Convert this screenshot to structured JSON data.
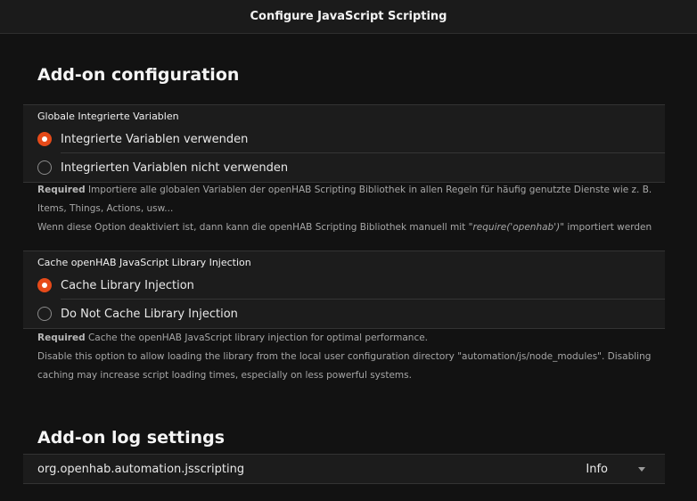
{
  "window": {
    "title": "Configure JavaScript Scripting"
  },
  "addon_configuration": {
    "title": "Add-on configuration",
    "globals": {
      "label": "Globale Integrierte Variablen",
      "options": [
        {
          "label": "Integrierte Variablen verwenden",
          "selected": true
        },
        {
          "label": "Integrierten Variablen nicht verwenden",
          "selected": false
        }
      ],
      "required": "Required",
      "desc_line1": " Importiere alle globalen Variablen der openHAB Scripting Bibliothek in allen Regeln für häufig genutzte Dienste wie z. B. Items, Things, Actions, usw...",
      "desc_line2_pre": "Wenn diese Option deaktiviert ist, dann kann die openHAB Scripting Bibliothek manuell mit \"",
      "desc_line2_code": "require('openhab')",
      "desc_line2_post": "\" importiert werden"
    },
    "cache": {
      "label": "Cache openHAB JavaScript Library Injection",
      "options": [
        {
          "label": "Cache Library Injection",
          "selected": true
        },
        {
          "label": "Do Not Cache Library Injection",
          "selected": false
        }
      ],
      "required": "Required",
      "desc_line1": " Cache the openHAB JavaScript library injection for optimal performance.",
      "desc_line2": "Disable this option to allow loading the library from the local user configuration directory \"automation/js/node_modules\". Disabling caching may increase script loading times, especially on less powerful systems."
    }
  },
  "log_settings": {
    "title": "Add-on log settings",
    "logger": "org.openhab.automation.jsscripting",
    "level": "Info"
  },
  "colors": {
    "accent": "#e64a19",
    "background": "#121212",
    "panel": "#1c1c1c"
  }
}
